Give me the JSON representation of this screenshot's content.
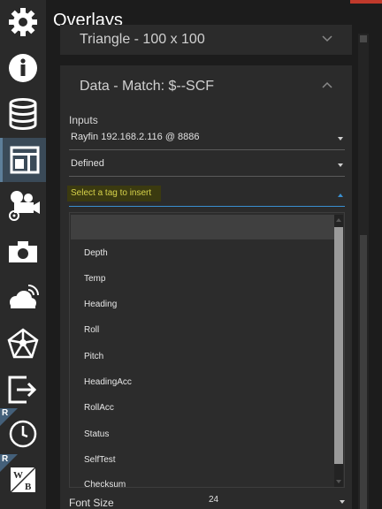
{
  "header": {
    "title": "Overlays"
  },
  "sidebar": {
    "items": [
      {
        "icon": "gear-icon"
      },
      {
        "icon": "info-icon"
      },
      {
        "icon": "database-icon"
      },
      {
        "icon": "layout-icon",
        "active": true
      },
      {
        "icon": "video-camera-settings-icon"
      },
      {
        "icon": "camera-icon"
      },
      {
        "icon": "cloud-wireless-icon"
      },
      {
        "icon": "network-icon"
      },
      {
        "icon": "export-icon"
      },
      {
        "icon": "clock-icon",
        "badge": "R"
      },
      {
        "icon": "white-balance-icon",
        "badge": "R",
        "icon_text": "WB"
      }
    ]
  },
  "cards": {
    "triangle": {
      "title": "Triangle - 100 x 100"
    },
    "data_match": {
      "title": "Data - Match: $--SCF"
    }
  },
  "inputs": {
    "label": "Inputs",
    "source": "Rayfin 192.168.2.116 @ 8886",
    "mode": "Defined",
    "tag_placeholder": "Select a tag to insert"
  },
  "tag_options": [
    "Depth",
    "Temp",
    "Heading",
    "Roll",
    "Pitch",
    "HeadingAcc",
    "RollAcc",
    "Status",
    "SelfTest",
    "Checksum"
  ],
  "font_size": {
    "label": "Font Size",
    "value": "24"
  },
  "colors": {
    "accent": "#3a8fd0",
    "highlight": "#d6d24a",
    "active_sidebar": "#3a4a58"
  }
}
